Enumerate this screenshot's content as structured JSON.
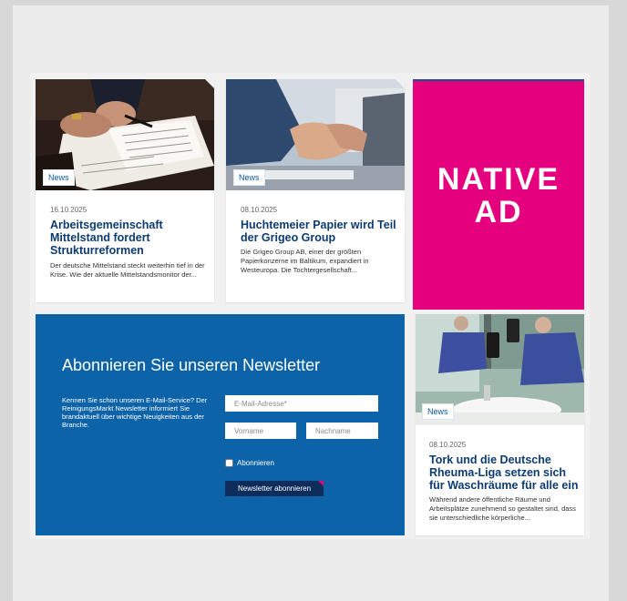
{
  "articles": [
    {
      "badge": "News",
      "date": "16.10.2025",
      "title": "Arbeitsgemeinschaft Mittelstand fordert Strukturreformen",
      "excerpt": "Der deutsche Mittelstand steckt weiterhin tief in der Krise. Wie der aktuelle Mittelstandsmonitor der..."
    },
    {
      "badge": "News",
      "date": "08.10.2025",
      "title": "Huchtemeier Papier wird Teil der Grigeo Group",
      "excerpt": "Die Grigeo Group AB, einer der größten Papierkonzerne im Baltikum, expandiert in Westeuropa. Die Tochtergesellschaft..."
    },
    {
      "badge": "News",
      "date": "08.10.2025",
      "title": "Tork und die Deutsche Rheuma-Liga setzen sich für Waschräume für alle ein",
      "excerpt": "Während andere öffentliche Räume und Arbeitsplätze zunehmend so gestaltet sind, dass sie unterschiedliche körperliche..."
    }
  ],
  "native_ad": {
    "label": "NATIVE\nAD",
    "color": "#e5007e"
  },
  "newsletter": {
    "title": "Abonnieren Sie unseren Newsletter",
    "description": "Kennen Sie schon unseren E-Mail-Service? Der ReinigungsMarkt Newsletter informiert Sie brandaktuell über wichtige Neuigkeiten aus der Branche.",
    "email_placeholder": "E-Mail-Adresse*",
    "firstname_placeholder": "Vorname",
    "lastname_placeholder": "Nachname",
    "checkbox_label": "Abonnieren",
    "button_label": "Newsletter abonnieren",
    "background_color": "#0d63a8"
  },
  "colors": {
    "title": "#0d3b73",
    "accent": "#e5007e"
  }
}
